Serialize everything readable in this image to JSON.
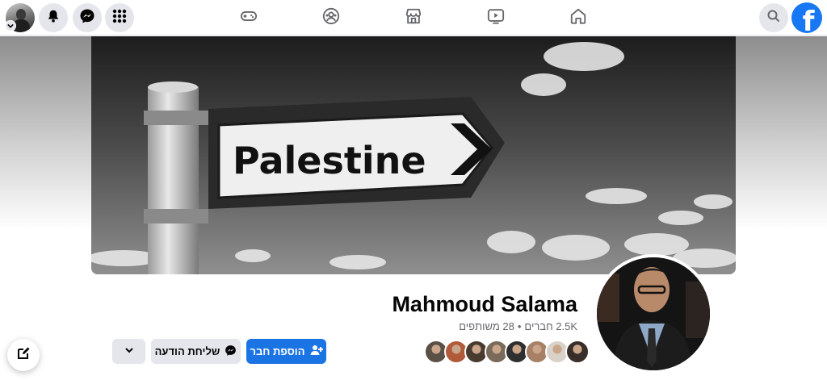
{
  "nav": {
    "icons": [
      "avatar",
      "bell-icon",
      "messenger-icon",
      "menu-grid-icon",
      "gaming-icon",
      "groups-icon",
      "marketplace-icon",
      "watch-icon",
      "home-icon",
      "search-icon",
      "facebook-logo"
    ],
    "logo_letter": "f",
    "brand_color": "#1877f2"
  },
  "cover": {
    "sign_text": "Palestine"
  },
  "profile": {
    "name": "Mahmoud Salama",
    "friends": "2.5K חברים",
    "mutual": "28 משותפים",
    "separator": "•"
  },
  "actions": {
    "add_friend_label": "הוספת חבר",
    "message_label": "שליחת הודעה"
  },
  "friend_avatars": [
    "#3a2e2a",
    "#d9d2c8",
    "#a78066",
    "#2f2f2f",
    "#7a6a5a",
    "#4a3b30",
    "#b05a3a",
    "#5a5046"
  ]
}
